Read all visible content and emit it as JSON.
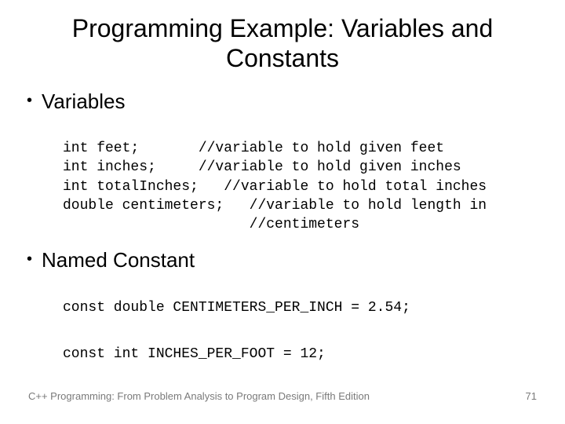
{
  "title": "Programming Example: Variables and Constants",
  "bullets": {
    "variables_label": "Variables",
    "constants_label": "Named Constant"
  },
  "code_variables": {
    "l1": "int feet;       //variable to hold given feet",
    "l2": "int inches;     //variable to hold given inches",
    "l3": "int totalInches;   //variable to hold total inches",
    "l4": "double centimeters;   //variable to hold length in",
    "l5": "                      //centimeters"
  },
  "code_constants": {
    "l1": "const double CENTIMETERS_PER_INCH = 2.54;",
    "l2": "const int INCHES_PER_FOOT = 12;"
  },
  "footer": {
    "book": "C++ Programming: From Problem Analysis to Program Design, Fifth Edition",
    "page": "71"
  }
}
